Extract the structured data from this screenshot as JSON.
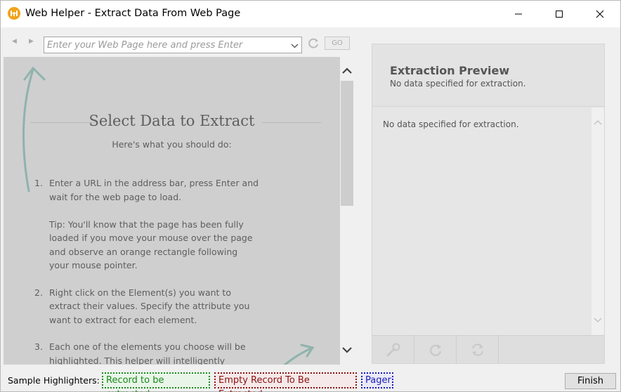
{
  "window": {
    "title": "Web Helper - Extract Data From Web Page"
  },
  "toolbar": {
    "back_icon": "back-arrow-icon",
    "forward_icon": "forward-arrow-icon",
    "url_placeholder": "Enter your Web Page here and press Enter",
    "url_value": "",
    "go_label": "GO"
  },
  "guide": {
    "title": "Select Data to Extract",
    "subtitle": "Here's what you should do:",
    "steps": [
      {
        "num": "1.",
        "text": "Enter a URL in the address bar, press Enter and wait for the web page to load.",
        "tip": "Tip: You'll know that the page has been fully loaded if you move your mouse over the page and observe an orange rectangle following your mouse pointer."
      },
      {
        "num": "2.",
        "text": "Right click on the Element(s) you want to extract their values. Specify the attribute you want to extract for each element."
      },
      {
        "num": "3.",
        "text": "Each one of the elements you choose will be highlighted. This helper will intelligently identify similar other elements."
      }
    ]
  },
  "preview": {
    "title": "Extraction Preview",
    "subtitle": "No data specified for extraction.",
    "body_text": "No data specified for extraction."
  },
  "status": {
    "label": "Sample Highlighters:",
    "record_label": "Record to be extracted",
    "empty_label": "Empty Record To Be Extracted",
    "pager_label": "Pager",
    "finish_label": "Finish"
  },
  "colors": {
    "accent": "#f2a319",
    "record": "#1a8a1a",
    "empty": "#8b1010",
    "pager": "#1a1ab8"
  }
}
